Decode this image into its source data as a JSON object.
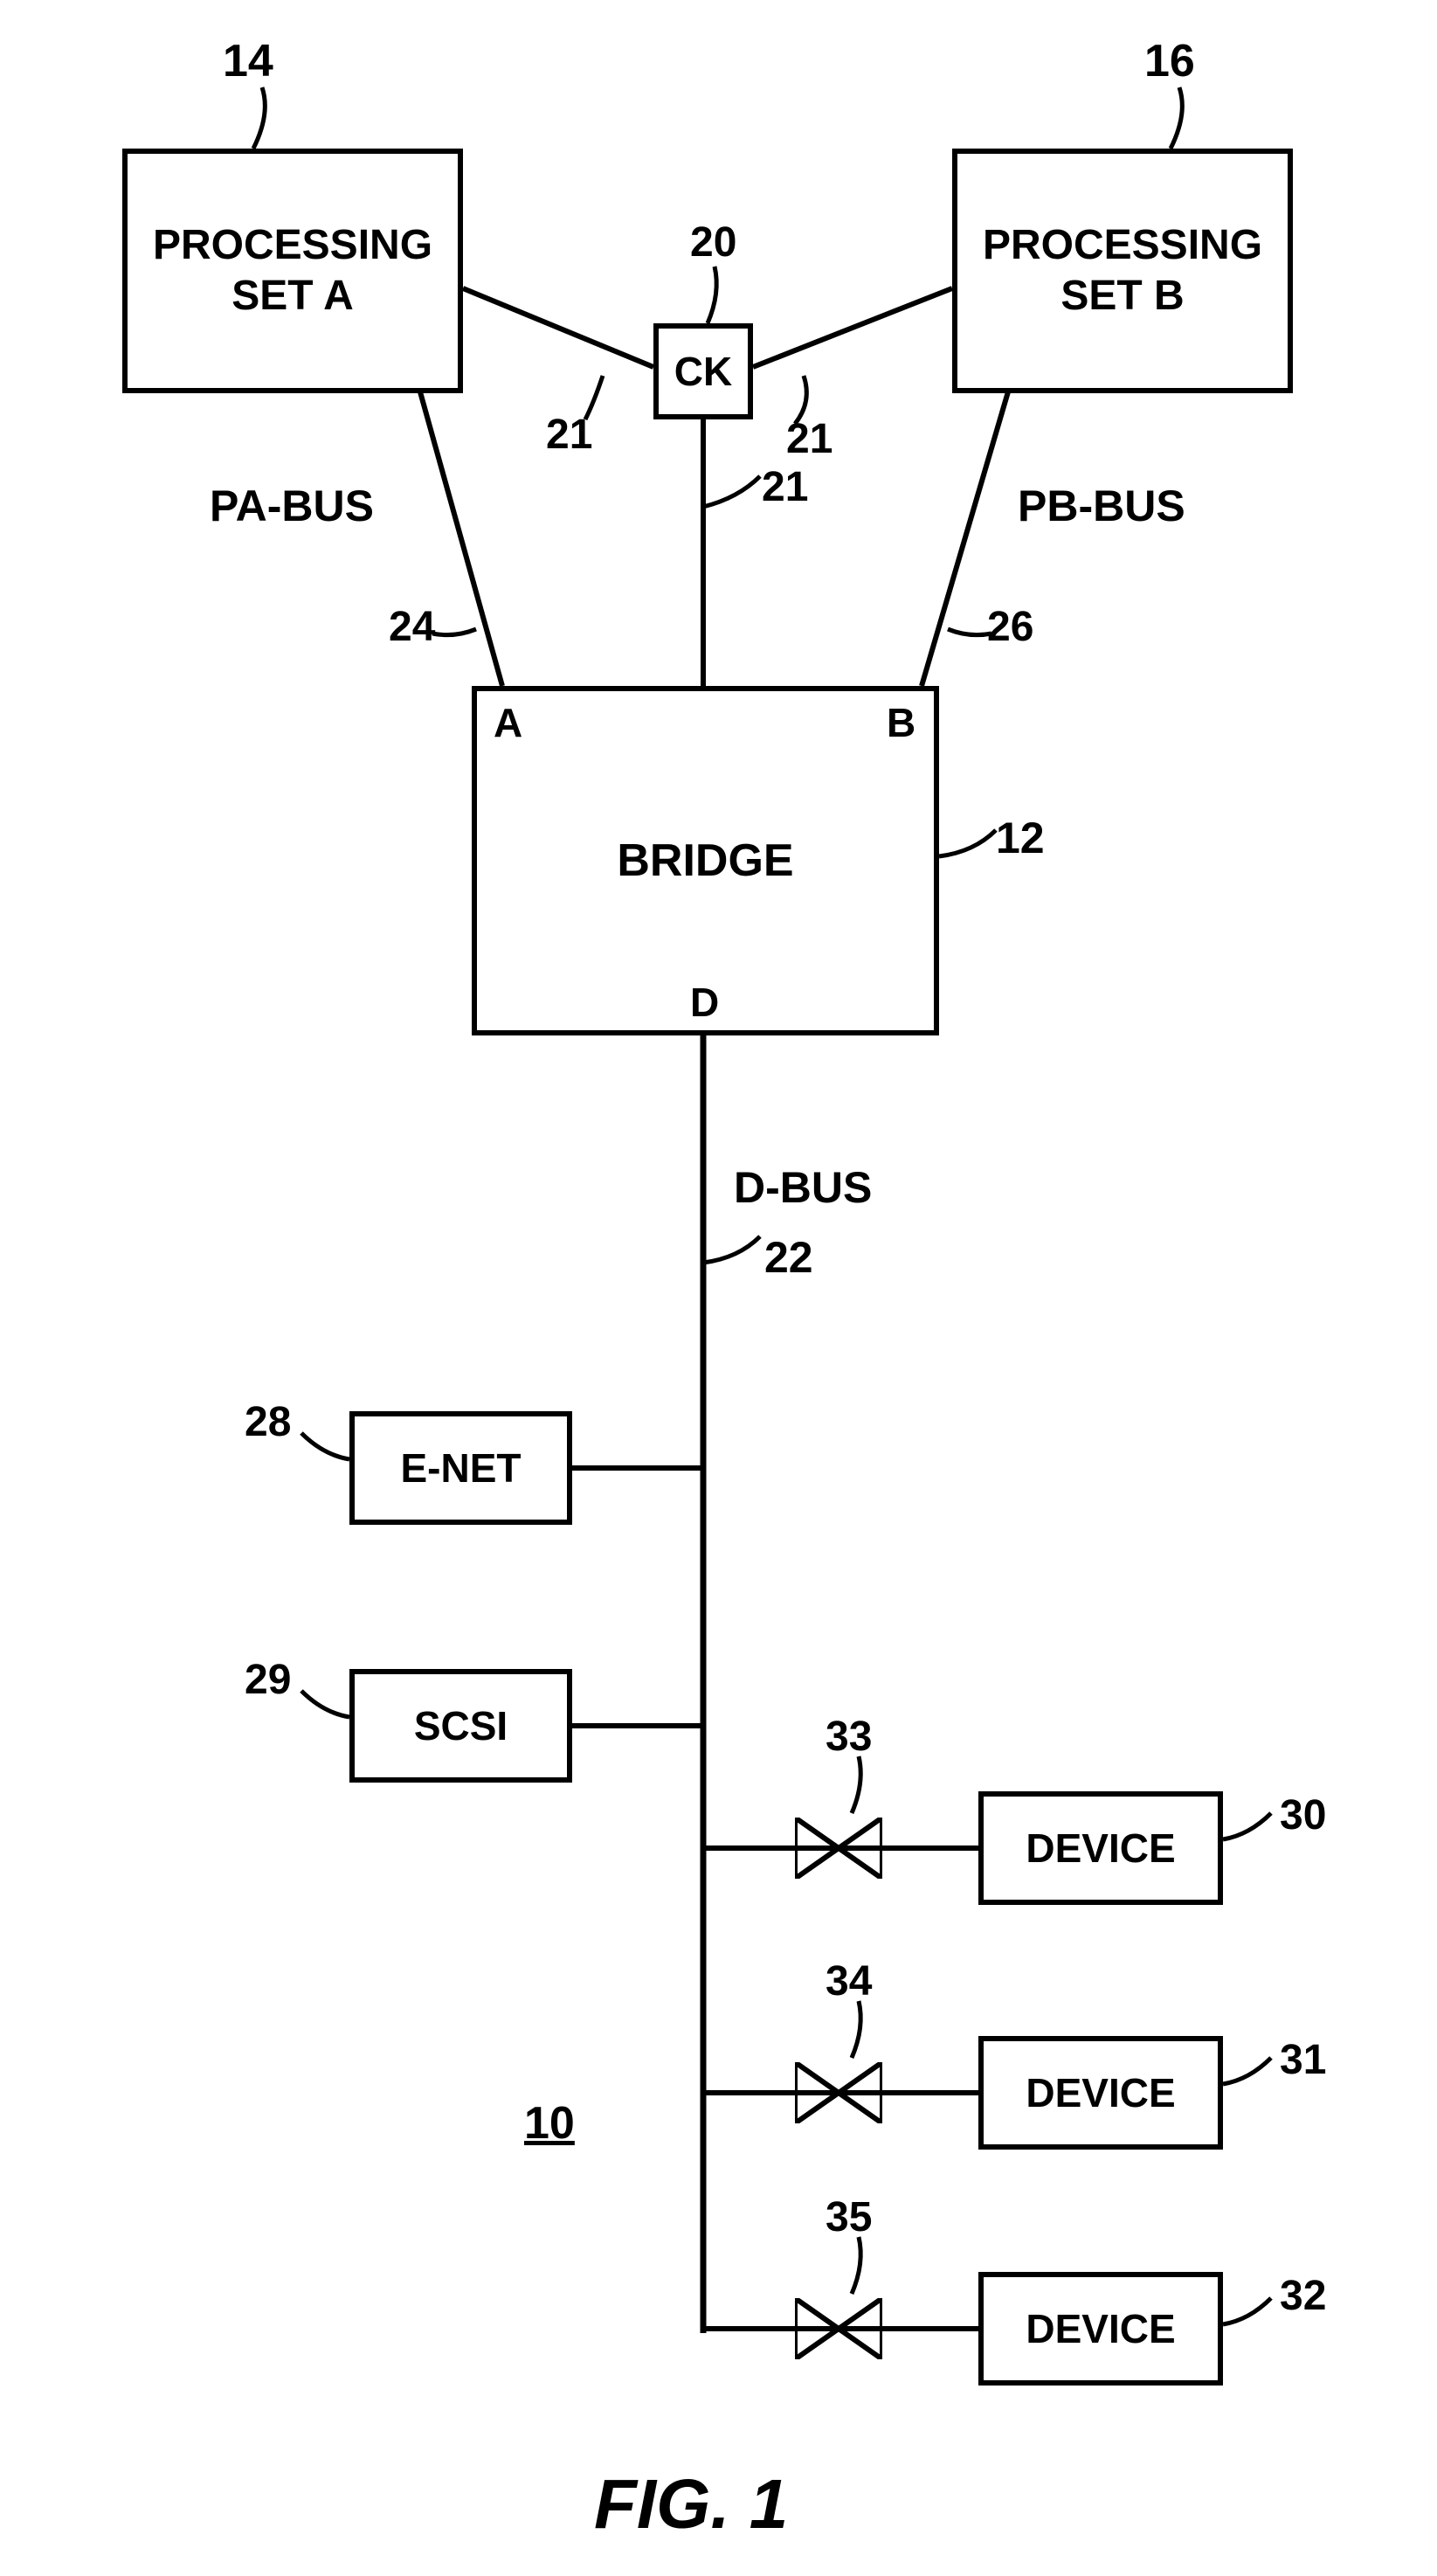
{
  "figure": {
    "title": "FIG. 1",
    "system_ref": "10"
  },
  "blocks": {
    "processing_a": {
      "label": "PROCESSING\nSET A",
      "ref": "14"
    },
    "processing_b": {
      "label": "PROCESSING\nSET B",
      "ref": "16"
    },
    "ck": {
      "label": "CK",
      "ref": "20"
    },
    "bridge": {
      "label": "BRIDGE",
      "ref": "12",
      "port_a": "A",
      "port_b": "B",
      "port_d": "D"
    },
    "enet": {
      "label": "E-NET",
      "ref": "28"
    },
    "scsi": {
      "label": "SCSI",
      "ref": "29"
    },
    "device1": {
      "label": "DEVICE",
      "ref": "30",
      "valve_ref": "33"
    },
    "device2": {
      "label": "DEVICE",
      "ref": "31",
      "valve_ref": "34"
    },
    "device3": {
      "label": "DEVICE",
      "ref": "32",
      "valve_ref": "35"
    }
  },
  "buses": {
    "pa": {
      "label": "PA-BUS",
      "ref": "24"
    },
    "pb": {
      "label": "PB-BUS",
      "ref": "26"
    },
    "d": {
      "label": "D-BUS",
      "ref": "22"
    },
    "ck_links": {
      "ref": "21"
    }
  }
}
